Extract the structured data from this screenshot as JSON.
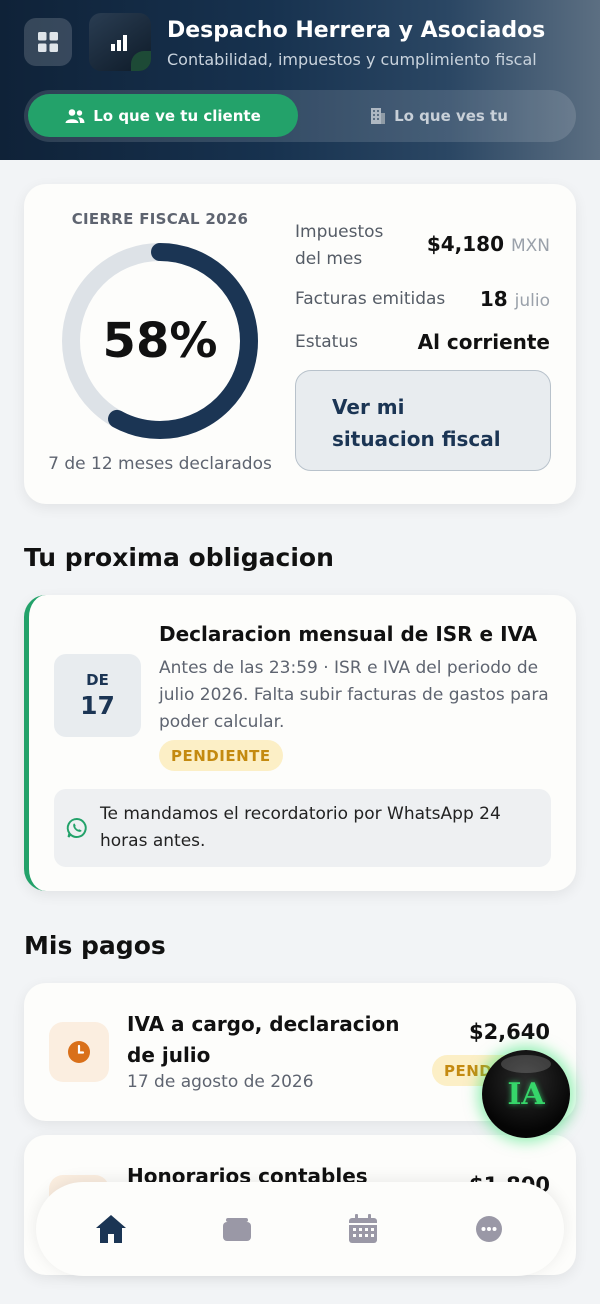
{
  "header": {
    "firm_name": "Despacho Herrera y Asociados",
    "firm_tagline": "Contabilidad, impuestos y cumplimiento fiscal",
    "toggle": {
      "client_view_label": "Lo que ve tu cliente",
      "your_view_label": "Lo que ves tu"
    }
  },
  "summary": {
    "cierre_label": "CIERRE FISCAL 2026",
    "progress_text": "58%",
    "progress_fraction": 0.58,
    "months_text": "7 de 12 meses declarados",
    "stats": [
      {
        "label": "Impuestos del mes",
        "value": "$4,180",
        "unit": "MXN"
      },
      {
        "label": "Facturas emitidas",
        "value": "18",
        "unit": "julio"
      },
      {
        "label": "Estatus",
        "value": "Al corriente",
        "unit": ""
      }
    ],
    "fiscal_button": "Ver mi situacion fiscal"
  },
  "next_obligation": {
    "section_title": "Tu proxima obligacion",
    "date_month": "DE",
    "date_day": "17",
    "title": "Declaracion mensual de ISR e IVA",
    "description": "Antes de las 23:59 · ISR e IVA del periodo de julio 2026. Falta subir facturas de gastos para poder calcular.",
    "badge": "PENDIENTE",
    "reminder": "Te mandamos el recordatorio por WhatsApp 24 horas antes."
  },
  "payments": {
    "section_title": "Mis pagos",
    "items": [
      {
        "title": "IVA a cargo, declaracion de julio",
        "date": "17 de agosto de 2026",
        "amount": "$2,640",
        "badge": "PENDIENTE"
      },
      {
        "title": "Honorarios contables",
        "date": "",
        "amount": "$1,800",
        "badge": ""
      }
    ]
  },
  "assistant": {
    "label": "IA"
  },
  "colors": {
    "accent_green": "#23a26a",
    "navy": "#1b3554",
    "pending": "#c48a10"
  },
  "bottom_nav": [
    "home-icon",
    "wallet-icon",
    "calendar-icon",
    "more-icon"
  ]
}
